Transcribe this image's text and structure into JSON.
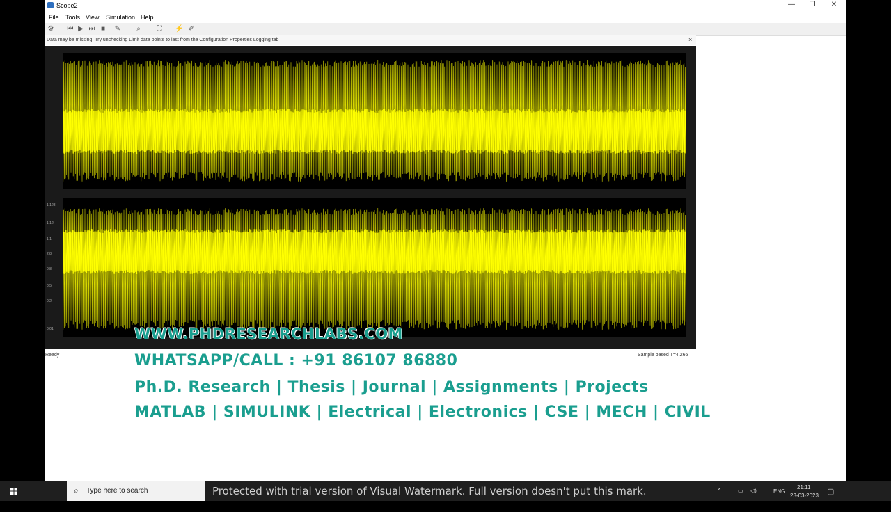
{
  "window": {
    "title": "Scope2",
    "controls": [
      "—",
      "❐",
      "✕"
    ]
  },
  "menu": [
    "File",
    "Tools",
    "View",
    "Simulation",
    "Help"
  ],
  "infobar": {
    "message": "Data may be missing. Try unchecking Limit data points to last from the Configuration Properties Logging tab",
    "close": "×"
  },
  "scope": {
    "trace_color": "#ffff00",
    "axes_color": "#000000",
    "bottom_axis_ticks": [
      "1.128",
      "1.12",
      "1.1",
      "2.8",
      "0.8",
      "0.5",
      "0.2",
      "0.01"
    ]
  },
  "status": {
    "left": "Ready",
    "right": "Sample based   T=4.266"
  },
  "watermark": {
    "site": "WWW.PHDRESEARCHLABS.COM",
    "phone": "WHATSAPP/CALL : +91 86107 86880",
    "services": "Ph.D. Research | Thesis | Journal | Assignments | Projects",
    "subjects": "MATLAB | SIMULINK | Electrical | Electronics | CSE | MECH | CIVIL",
    "color": "#1a9e8f"
  },
  "taskbar": {
    "search_placeholder": "Type here to search",
    "trial_notice": "Protected with trial version of Visual Watermark. Full version doesn't put this mark.",
    "lang": "ENG",
    "time": "21:11",
    "date": "23-03-2023"
  }
}
